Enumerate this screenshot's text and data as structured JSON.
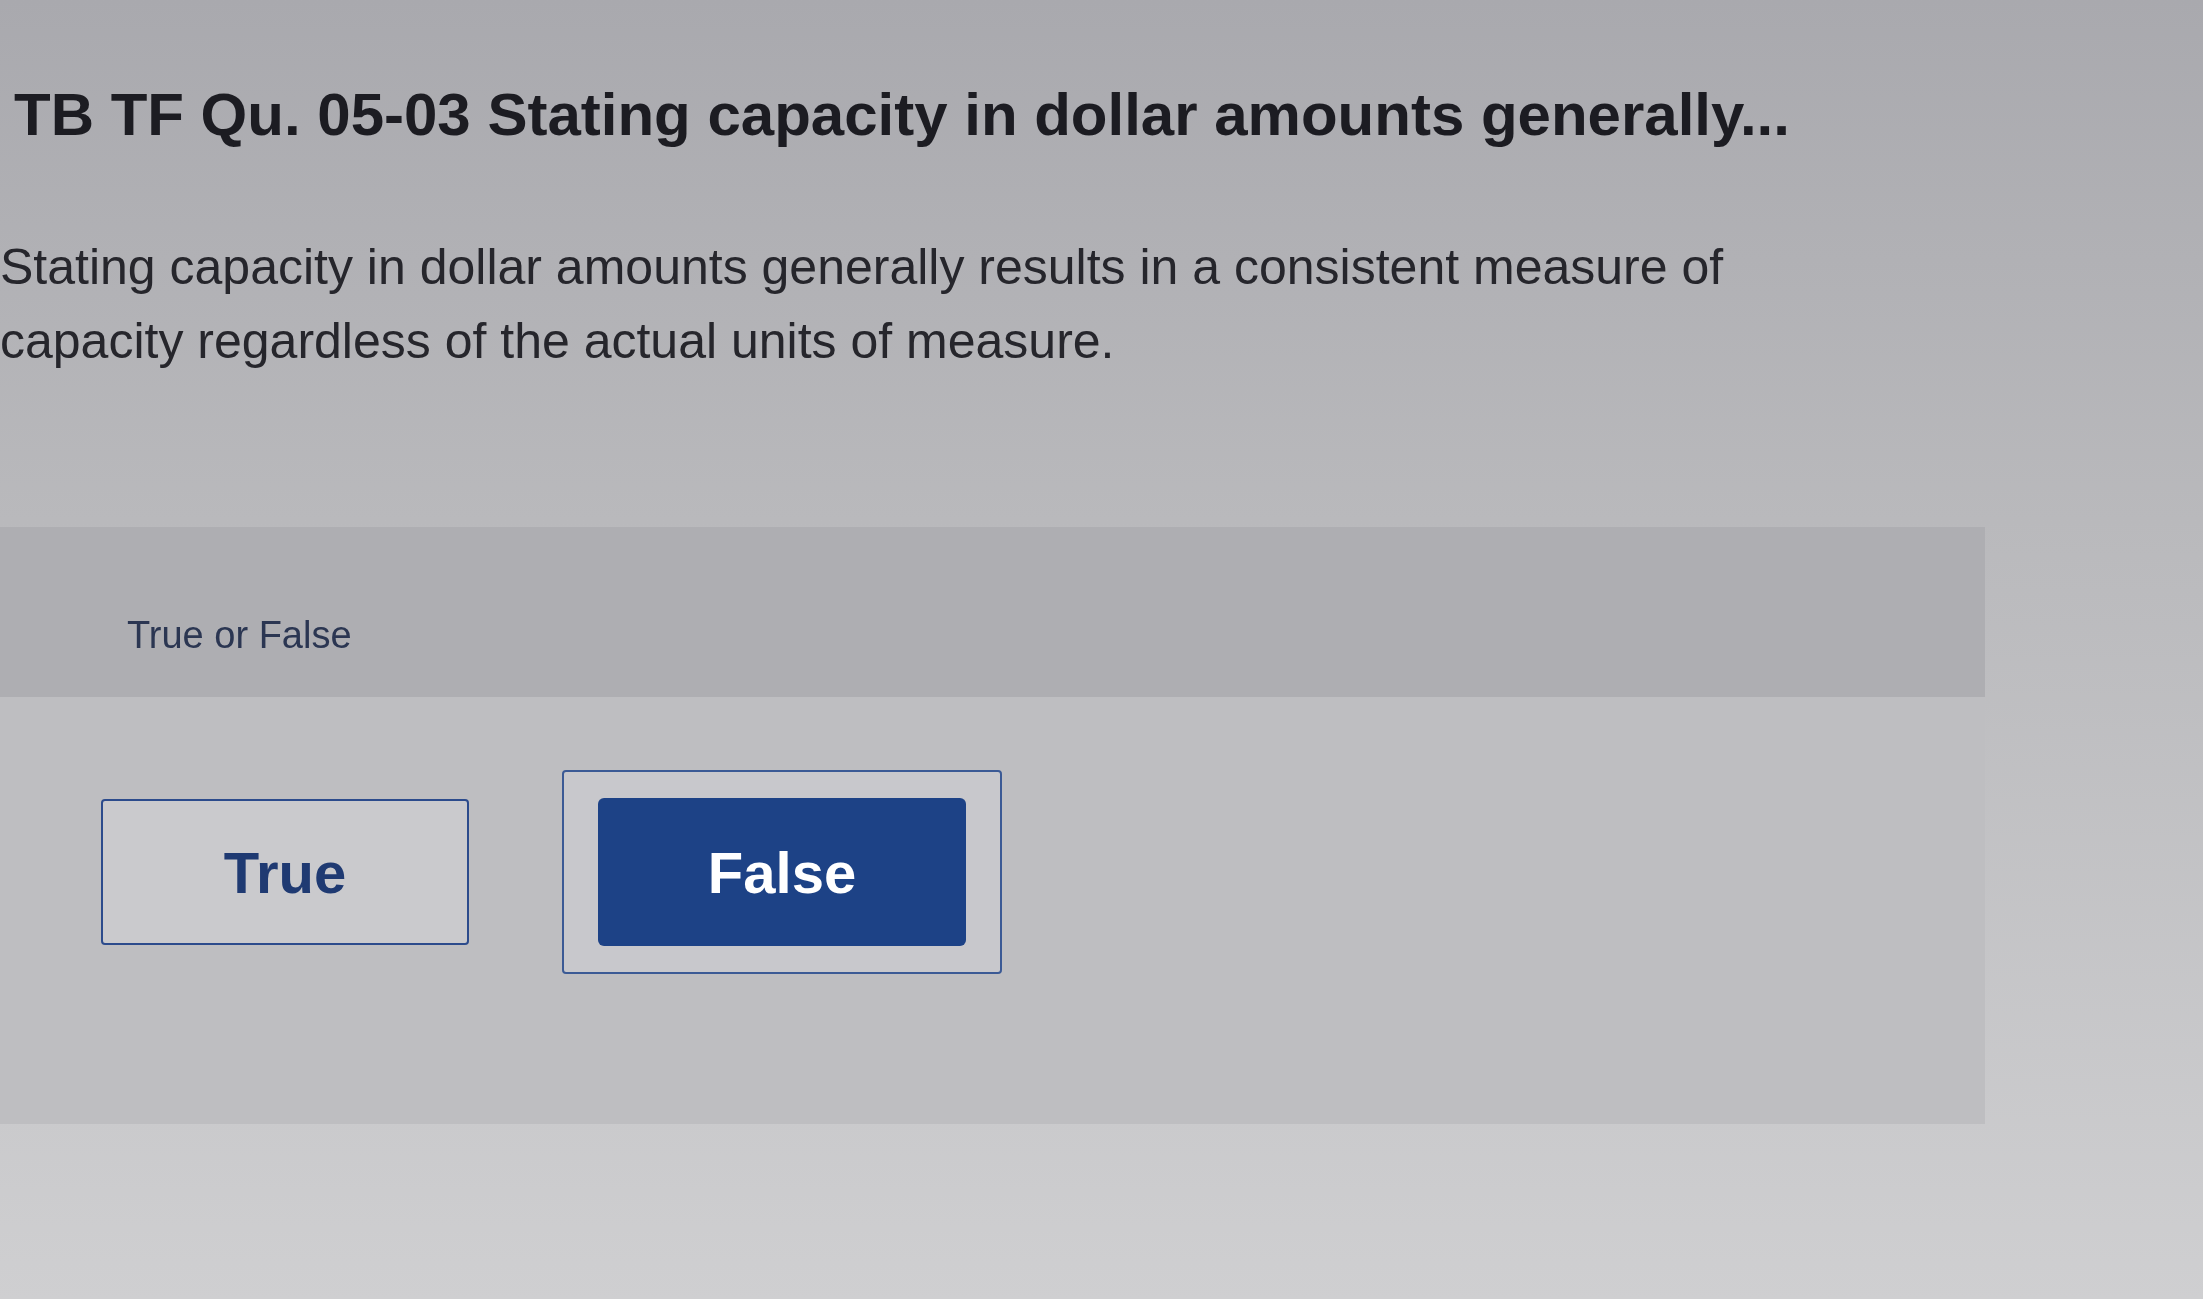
{
  "question": {
    "title": "TB TF Qu. 05-03 Stating capacity in dollar amounts generally...",
    "text": "Stating capacity in dollar amounts generally results in a consistent measure of capacity regardless of the actual units of measure."
  },
  "answer_panel": {
    "label": "True or False",
    "options": [
      {
        "label": "True",
        "selected": false
      },
      {
        "label": "False",
        "selected": true
      }
    ]
  }
}
